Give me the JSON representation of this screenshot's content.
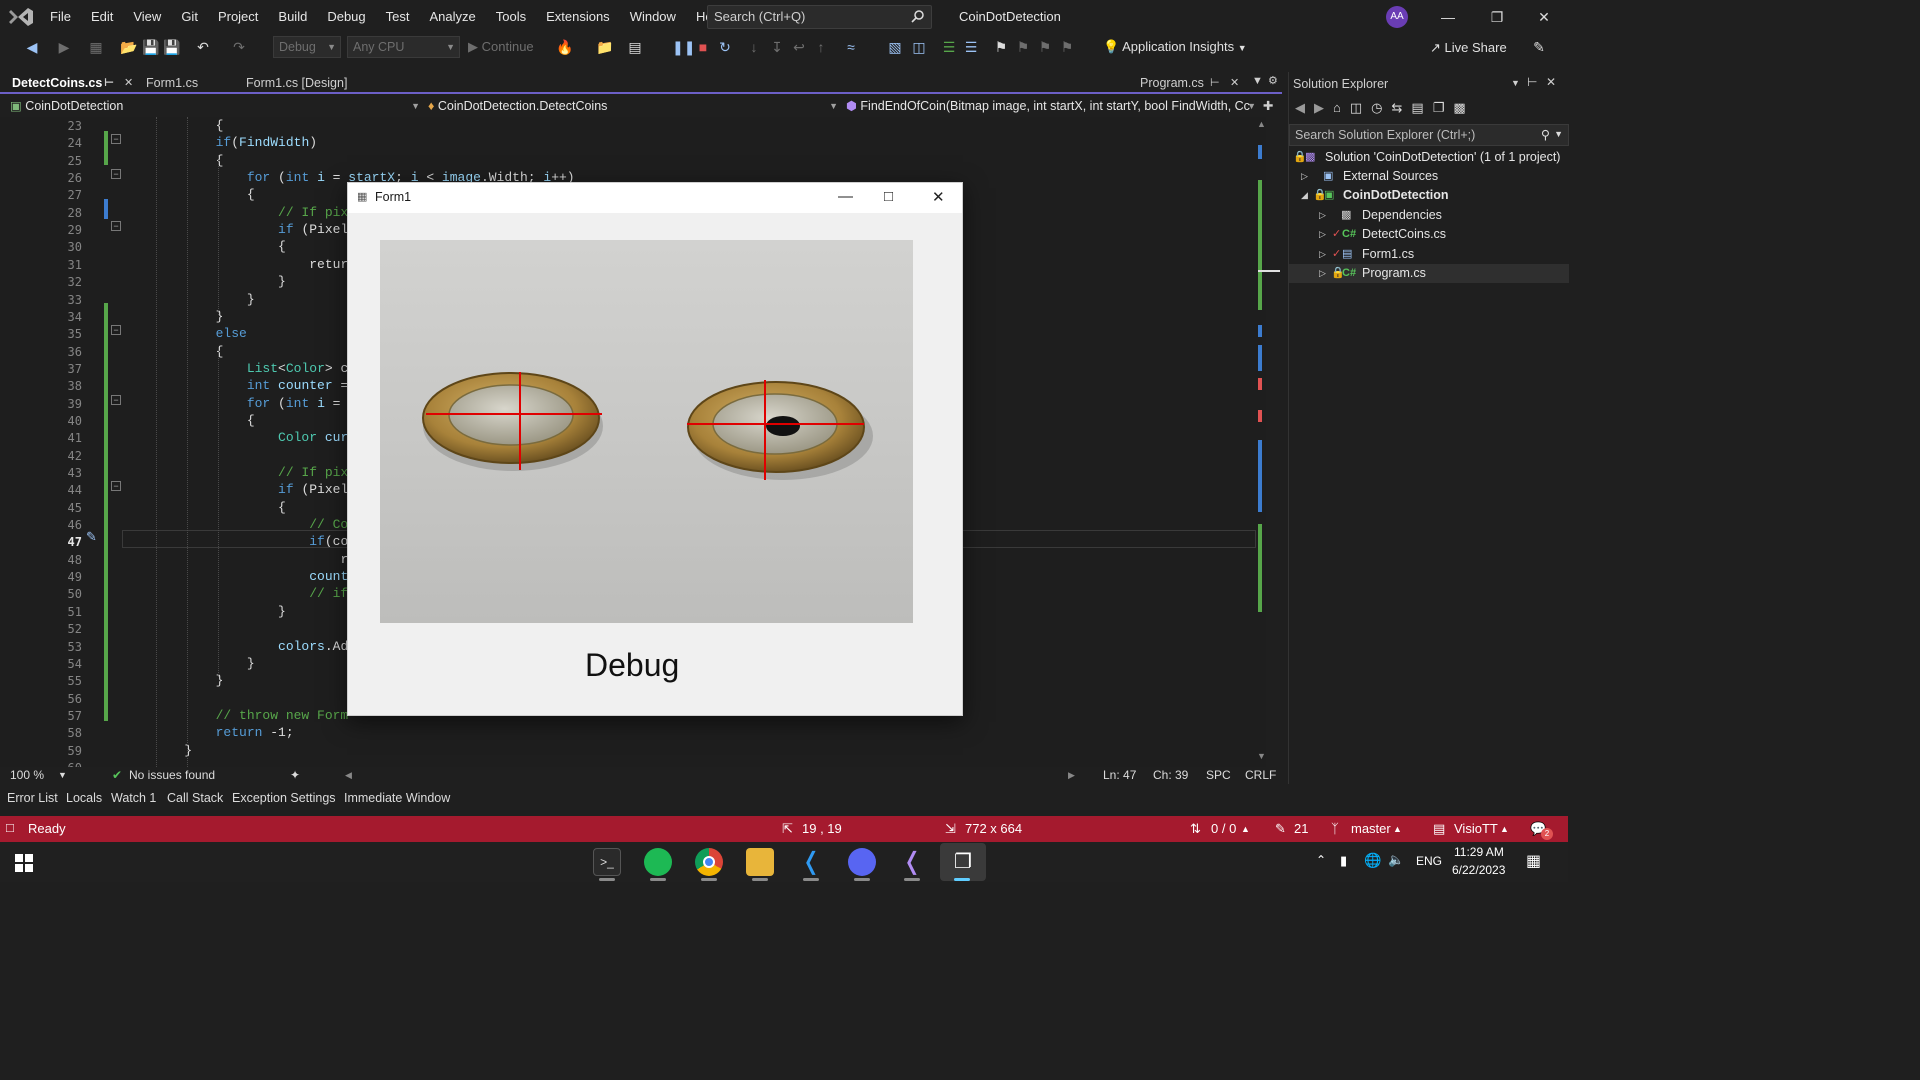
{
  "menu": {
    "items": [
      "File",
      "Edit",
      "View",
      "Git",
      "Project",
      "Build",
      "Debug",
      "Test",
      "Analyze",
      "Tools",
      "Extensions",
      "Window",
      "Help"
    ],
    "search_placeholder": "Search (Ctrl+Q)",
    "window_title": "CoinDotDetection",
    "account_initials": "AA"
  },
  "toolbar": {
    "config": "Debug",
    "platform": "Any CPU",
    "continue_label": "Continue",
    "app_insights": "Application Insights",
    "live_share": "Live Share"
  },
  "tabs": [
    {
      "label": "DetectCoins.cs",
      "active": true
    },
    {
      "label": "Form1.cs",
      "active": false
    },
    {
      "label": "Form1.cs [Design]",
      "active": false
    },
    {
      "label": "Program.cs",
      "active": false
    }
  ],
  "navbar": {
    "project": "CoinDotDetection",
    "type": "CoinDotDetection.DetectCoins",
    "member": "FindEndOfCoin(Bitmap image, int startX, int startY, bool FindWidth, Cc"
  },
  "editor": {
    "current_line": 47,
    "lines": [
      {
        "n": "23",
        "t": "            {"
      },
      {
        "n": "24",
        "t": "            if(FindWidth)"
      },
      {
        "n": "25",
        "t": "            {"
      },
      {
        "n": "26",
        "t": "                for (int i = startX; i < image.Width; i++)"
      },
      {
        "n": "27",
        "t": "                {"
      },
      {
        "n": "28",
        "t": "                    // If pix"
      },
      {
        "n": "29",
        "t": "                    if (Pixel"
      },
      {
        "n": "30",
        "t": "                    {"
      },
      {
        "n": "31",
        "t": "                        retur"
      },
      {
        "n": "32",
        "t": "                    }"
      },
      {
        "n": "33",
        "t": "                }"
      },
      {
        "n": "34",
        "t": "            }"
      },
      {
        "n": "35",
        "t": "            else"
      },
      {
        "n": "36",
        "t": "            {"
      },
      {
        "n": "37",
        "t": "                List<Color> c"
      },
      {
        "n": "38",
        "t": "                int counter ="
      },
      {
        "n": "39",
        "t": "                for (int i ="
      },
      {
        "n": "40",
        "t": "                {"
      },
      {
        "n": "41",
        "t": "                    Color cur"
      },
      {
        "n": "42",
        "t": ""
      },
      {
        "n": "43",
        "t": "                    // If pix"
      },
      {
        "n": "44",
        "t": "                    if (Pixel"
      },
      {
        "n": "45",
        "t": "                    {"
      },
      {
        "n": "46",
        "t": "                        // Co"
      },
      {
        "n": "47",
        "t": "                        if(co"
      },
      {
        "n": "48",
        "t": "                            r"
      },
      {
        "n": "49",
        "t": "                        count"
      },
      {
        "n": "50",
        "t": "                        // if"
      },
      {
        "n": "51",
        "t": "                    }"
      },
      {
        "n": "52",
        "t": ""
      },
      {
        "n": "53",
        "t": "                    colors.Ad"
      },
      {
        "n": "54",
        "t": "                }"
      },
      {
        "n": "55",
        "t": "            }"
      },
      {
        "n": "56",
        "t": ""
      },
      {
        "n": "57",
        "t": "            // throw new Form"
      },
      {
        "n": "58",
        "t": "            return -1;"
      },
      {
        "n": "59",
        "t": "        }"
      },
      {
        "n": "60",
        "t": ""
      }
    ]
  },
  "editor_status": {
    "zoom": "100 %",
    "issues": "No issues found",
    "line": "Ln: 47",
    "col": "Ch: 39",
    "spacing": "SPC",
    "eol": "CRLF"
  },
  "solution_explorer": {
    "title": "Solution Explorer",
    "search_placeholder": "Search Solution Explorer (Ctrl+;)",
    "items": [
      {
        "label": "Solution 'CoinDotDetection' (1 of 1 project)",
        "bold": false
      },
      {
        "label": "External Sources",
        "bold": false
      },
      {
        "label": "CoinDotDetection",
        "bold": true
      },
      {
        "label": "Dependencies",
        "bold": false
      },
      {
        "label": "DetectCoins.cs",
        "bold": false
      },
      {
        "label": "Form1.cs",
        "bold": false
      },
      {
        "label": "Program.cs",
        "bold": false
      }
    ]
  },
  "bottom_tabs": [
    "Error List",
    "Locals",
    "Watch 1",
    "Call Stack",
    "Exception Settings",
    "Immediate Window"
  ],
  "statusbar": {
    "ready": "Ready",
    "position": "19 , 19",
    "size": "772 x 664",
    "sync": "0 / 0",
    "edits": "21",
    "branch": "master",
    "repo": "VisioTT",
    "notifications": "2"
  },
  "taskbar": {
    "lang": "ENG",
    "time": "11:29 AM",
    "date": "6/22/2023"
  },
  "form1": {
    "title": "Form1",
    "label": "Debug"
  },
  "colors": {
    "accent": "#6c5fc7",
    "statusbar": "#a51a2e",
    "crosshair": "#e00000"
  }
}
